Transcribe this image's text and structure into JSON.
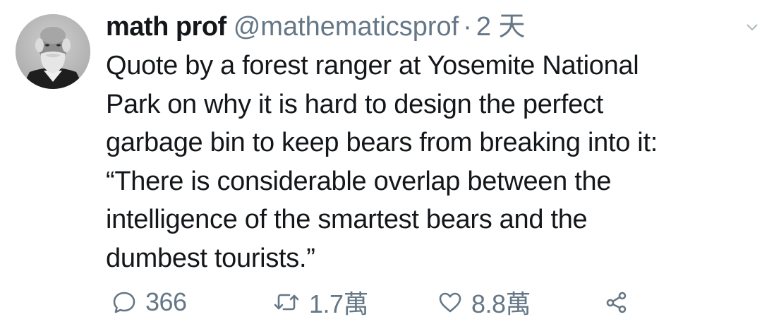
{
  "tweet": {
    "author": {
      "display_name": "math prof",
      "handle": "@mathematicsprof",
      "separator": "·",
      "time": "2 天",
      "avatar_icon": "profile-photo-bearded-man"
    },
    "text_lines": [
      "Quote by a forest ranger at Yosemite National",
      "Park on why it is hard to design the perfect",
      "garbage bin to keep bears from breaking into it:",
      "“There is considerable overlap between the",
      "intelligence of the smartest bears and the",
      "dumbest tourists.”"
    ],
    "actions": {
      "reply": {
        "icon": "reply-icon",
        "count": "366"
      },
      "retweet": {
        "icon": "retweet-icon",
        "count": "1.7萬"
      },
      "like": {
        "icon": "heart-icon",
        "count": "8.8萬"
      },
      "share": {
        "icon": "share-icon"
      }
    },
    "menu_icon": "chevron-down-icon"
  },
  "colors": {
    "text_primary": "#14171a",
    "text_secondary": "#657786",
    "background": "#ffffff"
  }
}
